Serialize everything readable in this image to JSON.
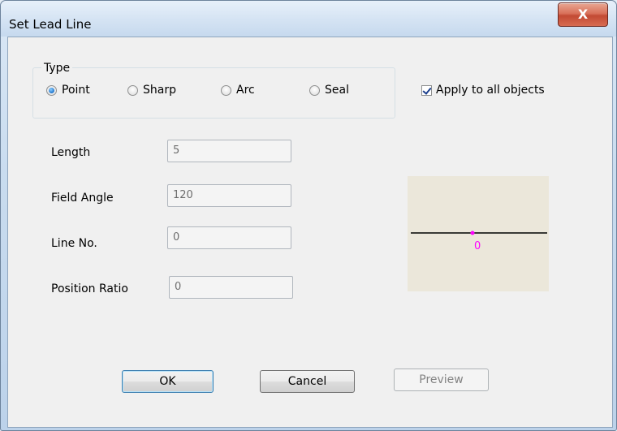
{
  "window": {
    "title": "Set Lead Line",
    "close_label": "X"
  },
  "type_group": {
    "label": "Type",
    "options": [
      {
        "label": "Point",
        "selected": true
      },
      {
        "label": "Sharp",
        "selected": false
      },
      {
        "label": "Arc",
        "selected": false
      },
      {
        "label": "Seal",
        "selected": false
      }
    ]
  },
  "apply_all": {
    "label": "Apply to all objects",
    "checked": true
  },
  "fields": [
    {
      "label": "Length",
      "value": "5"
    },
    {
      "label": "Field Angle",
      "value": "120"
    },
    {
      "label": "Line No.",
      "value": "0"
    },
    {
      "label": "Position Ratio",
      "value": "0"
    }
  ],
  "preview": {
    "marker_label": "0",
    "line_color": "#000000",
    "marker_color": "#ff00ff",
    "background": "#ebe7da"
  },
  "buttons": {
    "ok": "OK",
    "cancel": "Cancel",
    "preview": "Preview"
  }
}
